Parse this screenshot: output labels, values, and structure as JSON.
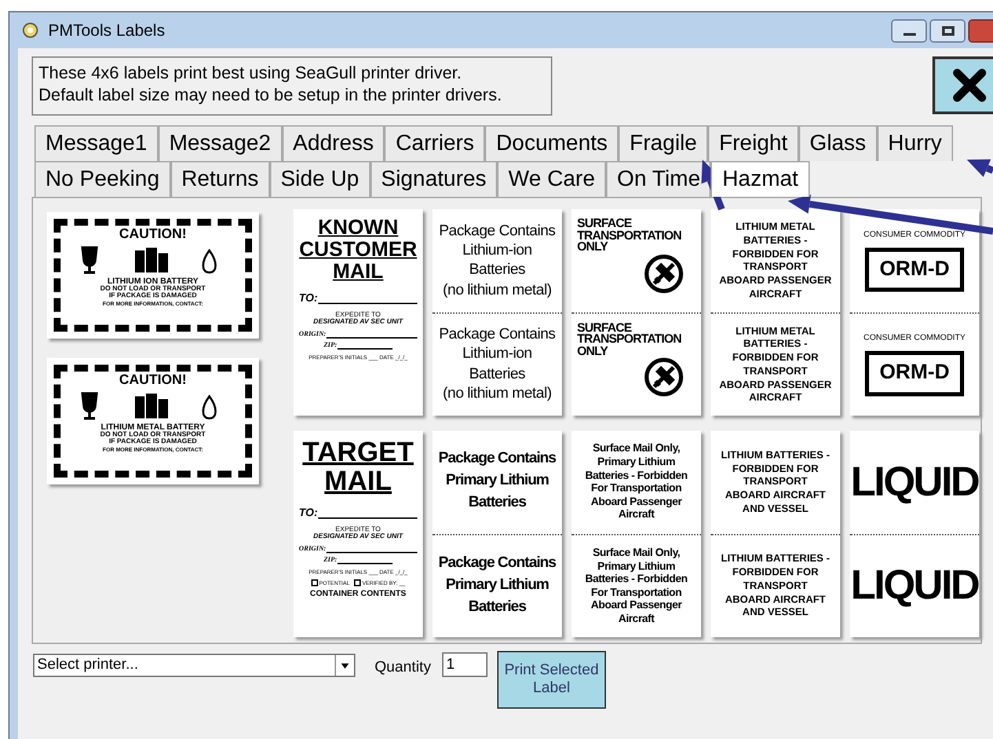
{
  "window": {
    "title": "PMTools Labels"
  },
  "info_lines": [
    "These 4x6 labels print best using SeaGull printer driver.",
    "Default label size may need to be setup in the printer drivers."
  ],
  "tab_rows": [
    [
      {
        "label": "Message1",
        "selected": false
      },
      {
        "label": "Message2",
        "selected": false
      },
      {
        "label": "Address",
        "selected": false
      },
      {
        "label": "Carriers",
        "selected": false
      },
      {
        "label": "Documents",
        "selected": false
      },
      {
        "label": "Fragile",
        "selected": false
      },
      {
        "label": "Freight",
        "selected": false
      },
      {
        "label": "Glass",
        "selected": false
      },
      {
        "label": "Hurry",
        "selected": false
      }
    ],
    [
      {
        "label": "No Peeking",
        "selected": false
      },
      {
        "label": "Returns",
        "selected": false
      },
      {
        "label": "Side Up",
        "selected": false
      },
      {
        "label": "Signatures",
        "selected": false
      },
      {
        "label": "We Care",
        "selected": false
      },
      {
        "label": "On Time",
        "selected": false
      },
      {
        "label": "Hazmat",
        "selected": true
      }
    ]
  ],
  "caution_labels": [
    {
      "heading": "CAUTION!",
      "battery": "LITHIUM ION BATTERY",
      "warning": [
        "DO NOT LOAD OR TRANSPORT",
        "IF PACKAGE IS DAMAGED"
      ],
      "contact": "FOR MORE INFORMATION, CONTACT:"
    },
    {
      "heading": "CAUTION!",
      "battery": "LITHIUM METAL BATTERY",
      "warning": [
        "DO NOT LOAD OR TRANSPORT",
        "IF PACKAGE IS DAMAGED"
      ],
      "contact": "FOR MORE INFORMATION, CONTACT:"
    }
  ],
  "labels": [
    {
      "kind": "mail",
      "title_lines": [
        "KNOWN",
        "CUSTOMER",
        "MAIL"
      ],
      "to": "TO:",
      "expedite": "EXPEDITE TO",
      "unit": "DESIGNATED AV SEC UNIT",
      "origin": "ORIGIN:",
      "zip": "ZIP:",
      "preparer": "PREPARER'S INITIALS ___ DATE _/_/_"
    },
    {
      "kind": "plain",
      "halves": [
        {
          "lines": [
            "Package Contains",
            "Lithium-ion",
            "Batteries",
            "(no lithium metal)"
          ]
        },
        {
          "lines": [
            "Package Contains",
            "Lithium-ion",
            "Batteries",
            "(no lithium metal)"
          ]
        }
      ]
    },
    {
      "kind": "surface",
      "halves": [
        {
          "lines": [
            "SURFACE",
            "TRANSPORTATION",
            "ONLY"
          ]
        },
        {
          "lines": [
            "SURFACE",
            "TRANSPORTATION",
            "ONLY"
          ]
        }
      ]
    },
    {
      "kind": "caps",
      "halves": [
        {
          "lines": [
            "LITHIUM METAL",
            "BATTERIES -",
            "FORBIDDEN FOR",
            "TRANSPORT",
            "ABOARD PASSENGER",
            "AIRCRAFT"
          ]
        },
        {
          "lines": [
            "LITHIUM METAL",
            "BATTERIES -",
            "FORBIDDEN FOR",
            "TRANSPORT",
            "ABOARD PASSENGER",
            "AIRCRAFT"
          ]
        }
      ]
    },
    {
      "kind": "orm",
      "halves": [
        {
          "caption": "CONSUMER COMMODITY",
          "lines": [
            "ORM-D"
          ]
        },
        {
          "caption": "CONSUMER COMMODITY",
          "lines": [
            "ORM-D"
          ]
        }
      ]
    },
    {
      "kind": "mail",
      "title_lines": [
        "TARGET",
        "MAIL"
      ],
      "to": "TO:",
      "expedite": "EXPEDITE TO",
      "unit": "DESIGNATED AV SEC UNIT",
      "origin": "ORIGIN:",
      "zip": "ZIP:",
      "preparer": "PREPARER'S INITIALS ___ DATE _/_/_",
      "checks": [
        {
          "label": "POTENTIAL",
          "checked": false
        },
        {
          "label": "VERIFIED BY: __",
          "checked": false
        }
      ],
      "contents": "CONTAINER CONTENTS"
    },
    {
      "kind": "condensed",
      "halves": [
        {
          "lines": [
            "Package Contains",
            "Primary Lithium",
            "Batteries"
          ]
        },
        {
          "lines": [
            "Package Contains",
            "Primary Lithium",
            "Batteries"
          ]
        }
      ]
    },
    {
      "kind": "heavy",
      "halves": [
        {
          "lines": [
            "Surface Mail Only,",
            "Primary Lithium",
            "Batteries - Forbidden",
            "For Transportation",
            "Aboard Passenger",
            "Aircraft"
          ]
        },
        {
          "lines": [
            "Surface Mail Only,",
            "Primary Lithium",
            "Batteries - Forbidden",
            "For Transportation",
            "Aboard Passenger",
            "Aircraft"
          ]
        }
      ]
    },
    {
      "kind": "caps",
      "halves": [
        {
          "lines": [
            "LITHIUM BATTERIES -",
            "FORBIDDEN FOR",
            "TRANSPORT",
            "ABOARD AIRCRAFT",
            "AND VESSEL"
          ]
        },
        {
          "lines": [
            "LITHIUM BATTERIES -",
            "FORBIDDEN FOR",
            "TRANSPORT",
            "ABOARD AIRCRAFT",
            "AND VESSEL"
          ]
        }
      ]
    },
    {
      "kind": "big",
      "halves": [
        {
          "lines": [
            "LIQUID"
          ]
        },
        {
          "lines": [
            "LIQUID"
          ]
        }
      ]
    }
  ],
  "printer": {
    "placeholder": "Select printer..."
  },
  "quantity": {
    "label": "Quantity",
    "value": "1"
  },
  "print_button": "Print Selected Label"
}
